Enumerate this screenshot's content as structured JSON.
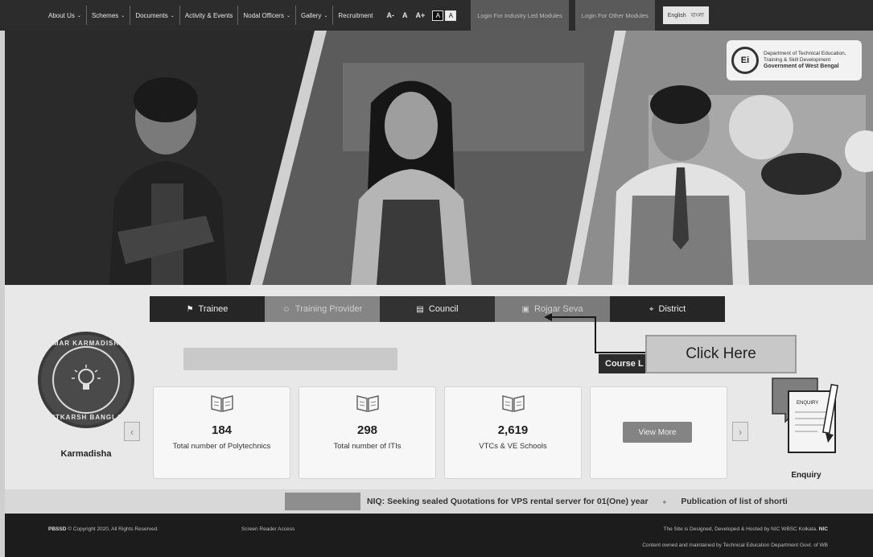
{
  "nav": {
    "items": [
      {
        "label": "About Us",
        "caret": "⌄"
      },
      {
        "label": "Schemes",
        "caret": "⌄"
      },
      {
        "label": "Documents",
        "caret": "⌄"
      },
      {
        "label": "Activity & Events",
        "caret": ""
      },
      {
        "label": "Nodal Officers",
        "caret": "⌄"
      },
      {
        "label": "Gallery",
        "caret": "⌄"
      },
      {
        "label": "Recruitment",
        "caret": ""
      }
    ],
    "font_decrease": "A-",
    "font_normal": "A",
    "font_increase": "A+",
    "theme_dark": "A",
    "theme_light": "A",
    "login_industry": "Login For Industry Led Modules",
    "login_other": "Login For Other Modules",
    "lang_english": "English",
    "lang_bangla": "বাংলা"
  },
  "hero": {
    "dept_line1": "Department of Technical Education,",
    "dept_line2": "Training & Skill Development",
    "dept_line3": "Government of West Bengal",
    "emblem_text": "Ei"
  },
  "tabs": [
    {
      "label": "Trainee",
      "icon": "graduation-cap-icon",
      "glyph": "⚑"
    },
    {
      "label": "Training Provider",
      "icon": "users-icon",
      "glyph": "☺"
    },
    {
      "label": "Council",
      "icon": "id-card-icon",
      "glyph": "▤"
    },
    {
      "label": "Rojgar Seva",
      "icon": "briefcase-icon",
      "glyph": "▣"
    },
    {
      "label": "District",
      "icon": "map-marker-icon",
      "glyph": "⌖"
    }
  ],
  "karmadisha": {
    "ring_top": "AMAR KARMADISHA",
    "ring_bottom": "UTKARSH BANGLA",
    "label": "Karmadisha"
  },
  "course_button": "Course L",
  "click_here": "Click Here",
  "stats": [
    {
      "value": "184",
      "label": "Total number of Polytechnics"
    },
    {
      "value": "298",
      "label": "Total number of ITIs"
    },
    {
      "value": "2,619",
      "label": "VTCs & VE Schools"
    }
  ],
  "view_more": "View More",
  "enquiry": {
    "label": "Enquiry",
    "form_text": "ENQUIRY"
  },
  "ticker": {
    "items": [
      "NIQ: Seeking sealed Quotations for VPS rental server for 01(One) year",
      "Publication of list of shorti"
    ]
  },
  "footer": {
    "copy_brand": "PBSSD",
    "copyright": "© Copyright 2020, All Rights Reserved.",
    "screen_reader": "Screen Reader Access",
    "designed_by": "The Site is Designed, Developed & Hosted by NIC WBSC Kolkata.",
    "nic": "NIC",
    "content_owned": "Content owned and maintained by Technical Education Department Govt. of WB"
  }
}
